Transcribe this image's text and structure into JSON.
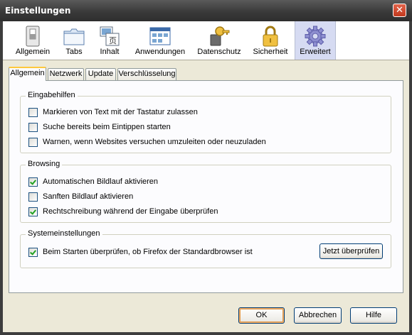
{
  "window": {
    "title": "Einstellungen",
    "close_symbol": "✕"
  },
  "toolbar": {
    "items": [
      {
        "label": "Allgemein",
        "icon": "switch-icon"
      },
      {
        "label": "Tabs",
        "icon": "tabs-icon"
      },
      {
        "label": "Inhalt",
        "icon": "content-icon"
      },
      {
        "label": "Anwendungen",
        "icon": "applications-icon"
      },
      {
        "label": "Datenschutz",
        "icon": "privacy-key-icon"
      },
      {
        "label": "Sicherheit",
        "icon": "padlock-icon"
      },
      {
        "label": "Erweitert",
        "icon": "gear-icon"
      }
    ],
    "selected": "Erweitert",
    "selected_color": "#d6dbf2"
  },
  "tabs": {
    "items": [
      "Allgemein",
      "Netzwerk",
      "Update",
      "Verschlüsselung"
    ],
    "active": "Allgemein"
  },
  "groups": {
    "accessibility": {
      "legend": "Eingabehilfen",
      "options": [
        {
          "label": "Markieren von Text mit der Tastatur zulassen",
          "checked": false
        },
        {
          "label": "Suche bereits beim Eintippen starten",
          "checked": false
        },
        {
          "label": "Warnen, wenn Websites versuchen umzuleiten oder neuzuladen",
          "checked": false
        }
      ]
    },
    "browsing": {
      "legend": "Browsing",
      "options": [
        {
          "label": "Automatischen Bildlauf aktivieren",
          "checked": true
        },
        {
          "label": "Sanften Bildlauf aktivieren",
          "checked": false
        },
        {
          "label": "Rechtschreibung während der Eingabe überprüfen",
          "checked": true
        }
      ]
    },
    "system": {
      "legend": "Systemeinstellungen",
      "options": [
        {
          "label": "Beim Starten überprüfen, ob Firefox der Standardbrowser ist",
          "checked": true
        }
      ],
      "check_now_button": "Jetzt überprüfen"
    }
  },
  "footer": {
    "ok": "OK",
    "cancel": "Abbrechen",
    "help": "Hilfe"
  }
}
